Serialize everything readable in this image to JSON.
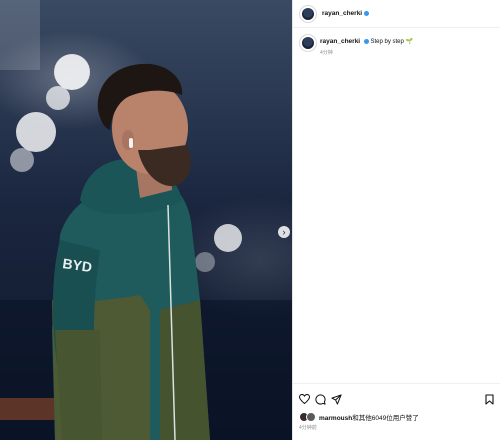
{
  "post": {
    "username": "rayan_cherki",
    "caption": "Step by step",
    "caption_emoji": "🌱",
    "caption_time": "4分钟",
    "likes_user": "marmoush",
    "likes_rest": "和其他6049位用户赞了",
    "post_time": "4分钟前"
  },
  "jacket_brand": "BYD",
  "colors": {
    "verified": "#3897f0",
    "jacket_teal": "#1f5a5c",
    "jacket_olive": "#4e5a33"
  },
  "icons": [
    "heart-icon",
    "comment-icon",
    "share-icon",
    "bookmark-icon",
    "chevron-right-icon",
    "verified-icon"
  ]
}
